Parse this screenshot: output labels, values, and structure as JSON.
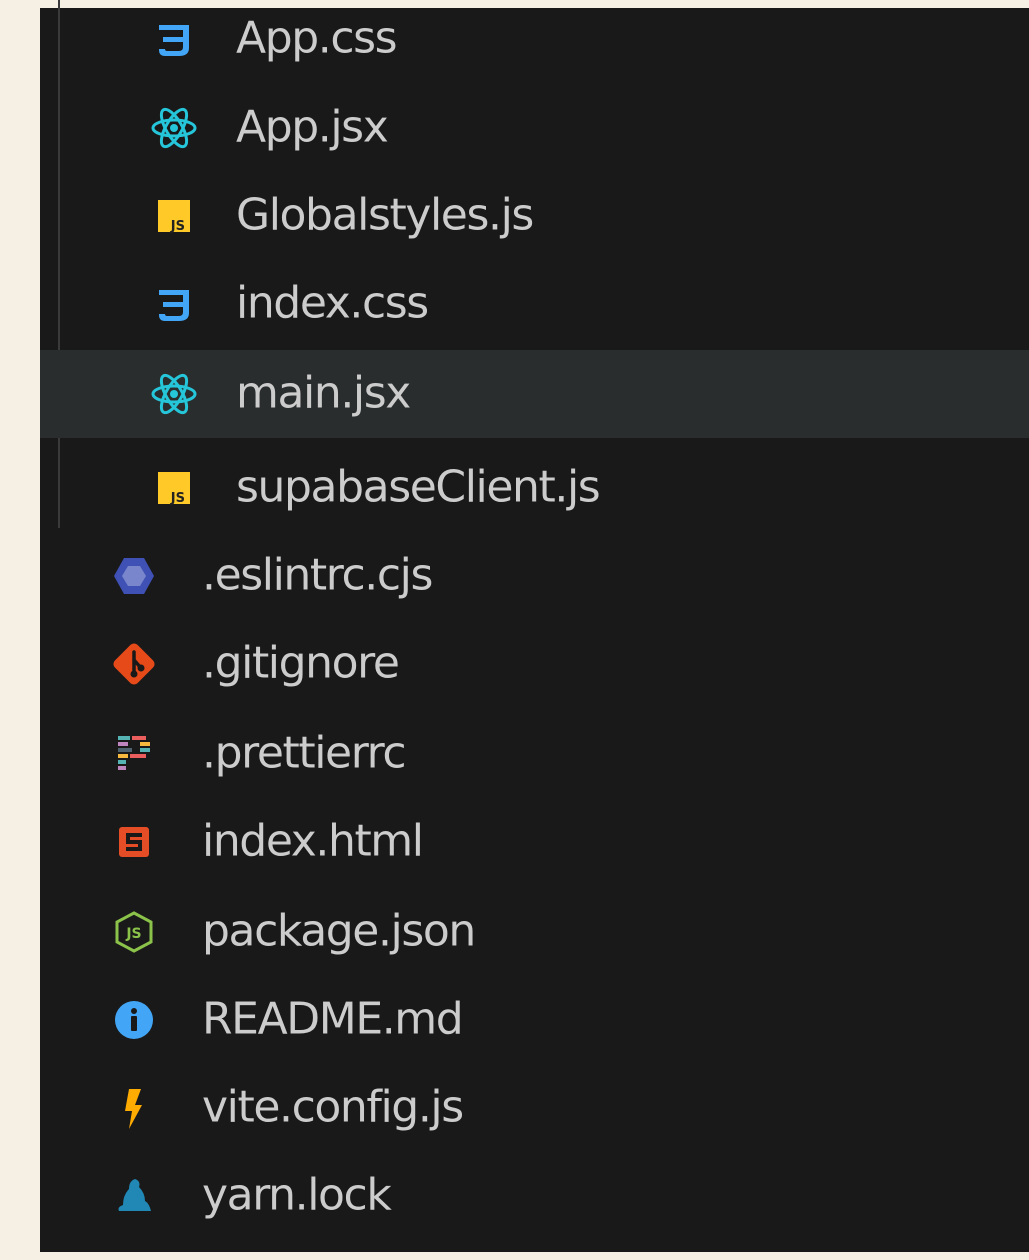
{
  "explorer": {
    "items": [
      {
        "name": "App.css",
        "icon": "css-icon",
        "depth": 1,
        "selected": false
      },
      {
        "name": "App.jsx",
        "icon": "react-icon",
        "depth": 1,
        "selected": false
      },
      {
        "name": "Globalstyles.js",
        "icon": "javascript-icon",
        "depth": 1,
        "selected": false
      },
      {
        "name": "index.css",
        "icon": "css-icon",
        "depth": 1,
        "selected": false
      },
      {
        "name": "main.jsx",
        "icon": "react-icon",
        "depth": 1,
        "selected": true
      },
      {
        "name": "supabaseClient.js",
        "icon": "javascript-icon",
        "depth": 1,
        "selected": false
      },
      {
        "name": ".eslintrc.cjs",
        "icon": "eslint-icon",
        "depth": 0,
        "selected": false
      },
      {
        "name": ".gitignore",
        "icon": "git-icon",
        "depth": 0,
        "selected": false
      },
      {
        "name": ".prettierrc",
        "icon": "prettier-icon",
        "depth": 0,
        "selected": false
      },
      {
        "name": "index.html",
        "icon": "html5-icon",
        "depth": 0,
        "selected": false
      },
      {
        "name": "package.json",
        "icon": "nodejs-icon",
        "depth": 0,
        "selected": false
      },
      {
        "name": "README.md",
        "icon": "info-icon",
        "depth": 0,
        "selected": false
      },
      {
        "name": "vite.config.js",
        "icon": "vite-icon",
        "depth": 0,
        "selected": false
      },
      {
        "name": "yarn.lock",
        "icon": "yarn-icon",
        "depth": 0,
        "selected": false
      }
    ]
  },
  "colors": {
    "background": "#191919",
    "selected_row": "#2a2d2e",
    "text": "#cccccc",
    "page_margin": "#f6efe4"
  }
}
